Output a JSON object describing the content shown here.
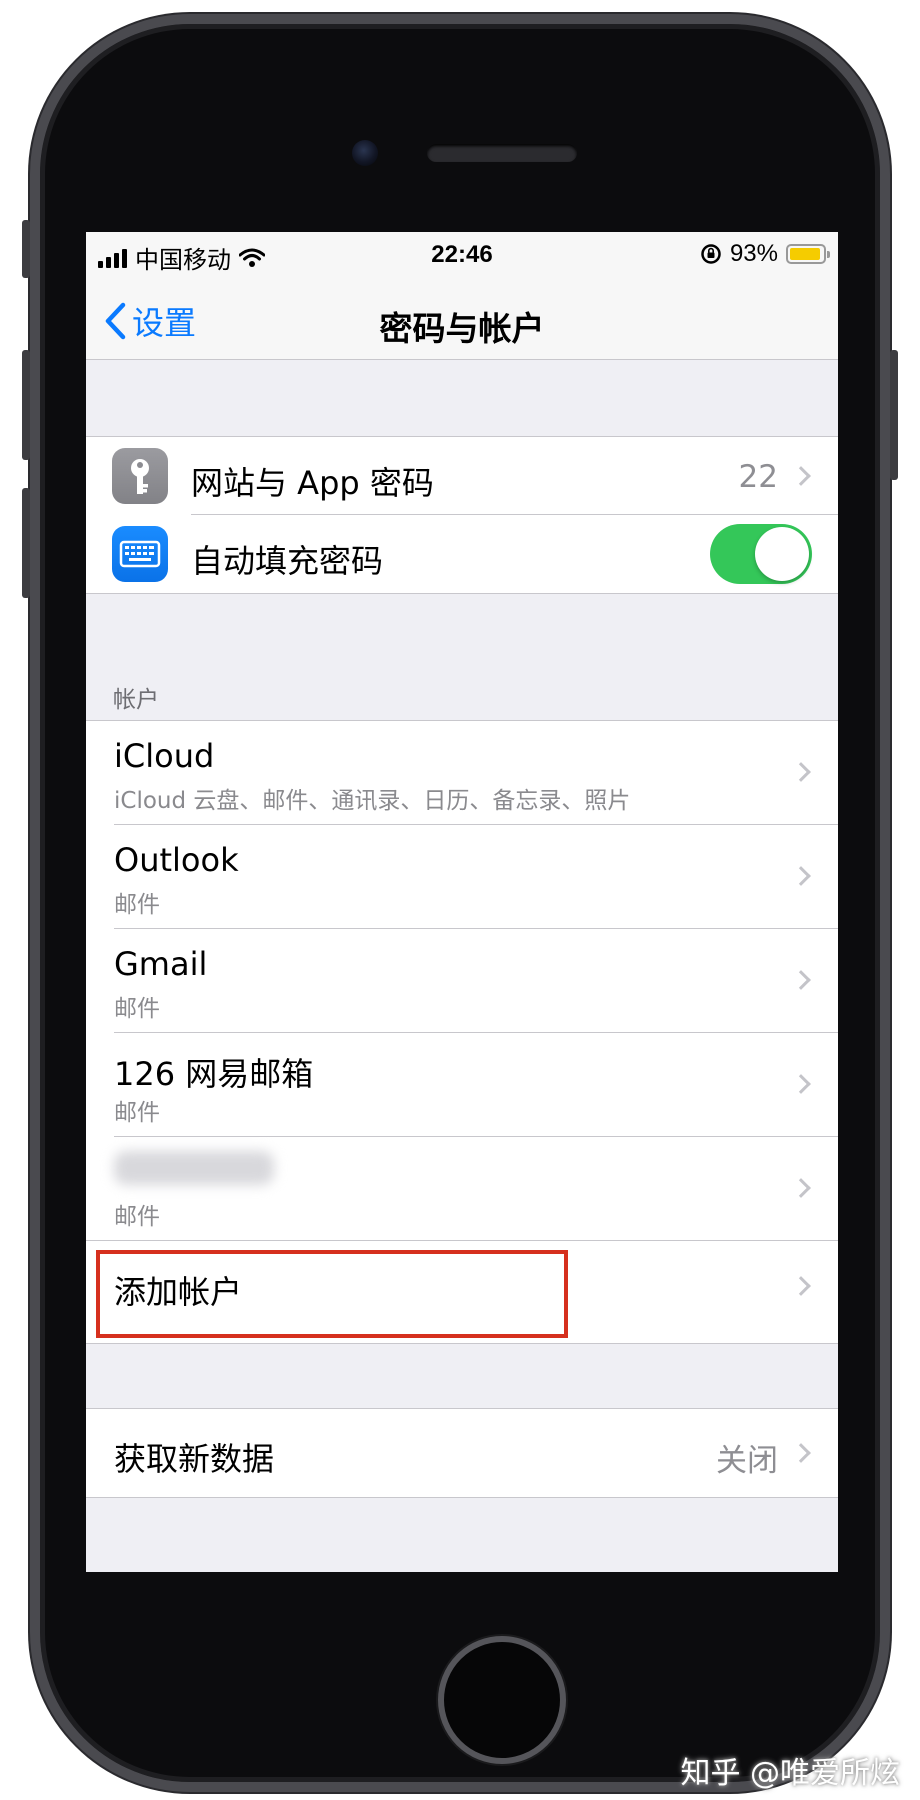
{
  "statusbar": {
    "carrier": "中国移动",
    "time": "22:46",
    "battery_percent": "93%",
    "battery_level": 0.93,
    "battery_color": "#f5cc00"
  },
  "navbar": {
    "back_label": "设置",
    "title": "密码与帐户"
  },
  "passwords_group": {
    "website_passwords": {
      "label": "网站与 App 密码",
      "count": "22",
      "icon": "key-icon"
    },
    "autofill": {
      "label": "自动填充密码",
      "enabled": true,
      "icon": "keyboard-icon"
    }
  },
  "accounts_section": {
    "header": "帐户",
    "accounts": [
      {
        "name": "iCloud",
        "detail": "iCloud 云盘、邮件、通讯录、日历、备忘录、照片"
      },
      {
        "name": "Outlook",
        "detail": "邮件"
      },
      {
        "name": "Gmail",
        "detail": "邮件"
      },
      {
        "name": "126 网易邮箱",
        "detail": "邮件"
      },
      {
        "name": "",
        "detail": "邮件"
      }
    ],
    "add_account": "添加帐户"
  },
  "fetch_group": {
    "label": "获取新数据",
    "value": "关闭"
  },
  "colors": {
    "accent": "#0a7aff",
    "toggle_on": "#34c759",
    "highlight": "#d6301e"
  },
  "watermark": "知乎 @唯爱所炫"
}
